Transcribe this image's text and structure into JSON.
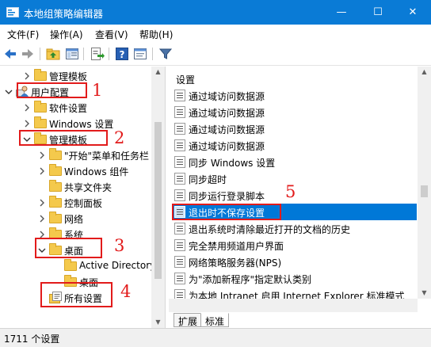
{
  "window": {
    "title": "本地组策略编辑器",
    "minimize_glyph": "—",
    "maximize_glyph": "☐",
    "close_glyph": "✕"
  },
  "menu": [
    "文件(F)",
    "操作(A)",
    "查看(V)",
    "帮助(H)"
  ],
  "toolbar": {
    "buttons": [
      "back-icon",
      "forward-icon",
      "up-folder-icon",
      "show-hide-tree-icon",
      "export-list-icon",
      "help-icon",
      "properties-view-icon",
      "filter-icon"
    ]
  },
  "tree": {
    "items": [
      {
        "label": "管理模板",
        "icon": "folder"
      },
      {
        "label": "用户配置",
        "icon": "user-config"
      },
      {
        "label": "软件设置",
        "icon": "folder"
      },
      {
        "label": "Windows 设置",
        "icon": "folder"
      },
      {
        "label": "管理模板",
        "icon": "folder"
      },
      {
        "label": "\"开始\"菜单和任务栏",
        "icon": "folder"
      },
      {
        "label": "Windows 组件",
        "icon": "folder"
      },
      {
        "label": "共享文件夹",
        "icon": "folder"
      },
      {
        "label": "控制面板",
        "icon": "folder"
      },
      {
        "label": "网络",
        "icon": "folder"
      },
      {
        "label": "系统",
        "icon": "folder"
      },
      {
        "label": "桌面",
        "icon": "folder"
      },
      {
        "label": "Active Directory",
        "icon": "folder"
      },
      {
        "label": "桌面",
        "icon": "folder"
      },
      {
        "label": "所有设置",
        "icon": "all-settings"
      }
    ]
  },
  "list": {
    "header": "设置",
    "rows": [
      "通过域访问数据源",
      "通过域访问数据源",
      "通过域访问数据源",
      "通过域访问数据源",
      "同步 Windows 设置",
      "同步超时",
      "同步运行登录脚本",
      "退出时不保存设置",
      "退出系统时清除最近打开的文档的历史",
      "完全禁用频道用户界面",
      "网络策略服务器(NPS)",
      "为\"添加新程序\"指定默认类别",
      "为本地 Intranet 启用 Internet Explorer 标准模式"
    ],
    "selected_index": 7
  },
  "tabs": [
    "扩展",
    "标准"
  ],
  "active_tab": "标准",
  "status": {
    "text": "1711 个设置"
  },
  "annotations": {
    "numbers": [
      "1",
      "2",
      "3",
      "4",
      "5"
    ],
    "color": "#e21b1b"
  },
  "colors": {
    "titlebar": "#0a7bd6",
    "selection": "#0078d7",
    "folder": "#f4c94c"
  }
}
